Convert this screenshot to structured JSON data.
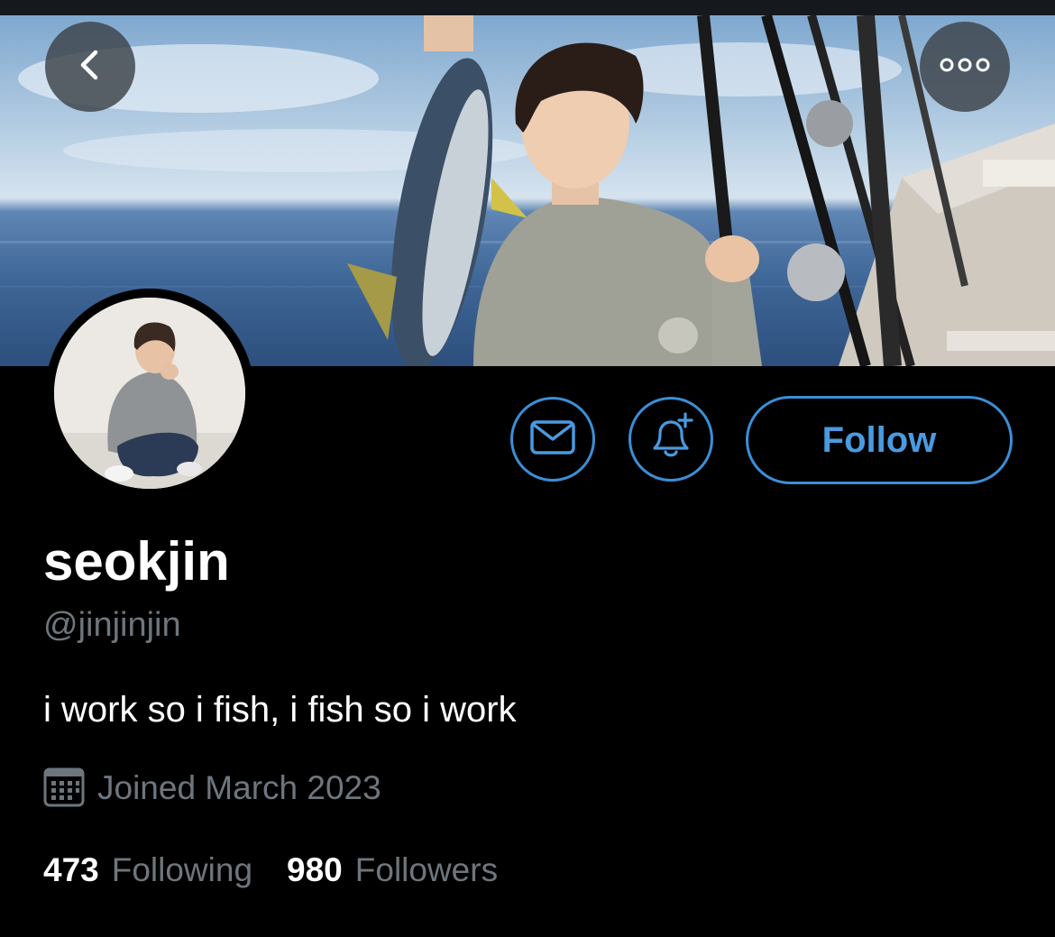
{
  "profile": {
    "display_name": "seokjin",
    "handle": "@jinjinjin",
    "bio": "i work so i fish, i fish so i work",
    "joined": "Joined March 2023",
    "following_count": "473",
    "following_label": "Following",
    "followers_count": "980",
    "followers_label": "Followers"
  },
  "actions": {
    "follow_label": "Follow",
    "message_icon": "envelope-icon",
    "notify_icon": "bell-plus-icon",
    "back_icon": "chevron-left-icon",
    "more_icon": "ellipsis-icon"
  },
  "colors": {
    "accent": "#3b8fd6",
    "background": "#000000",
    "secondary_text": "#6e767d",
    "primary_text": "#ffffff"
  }
}
